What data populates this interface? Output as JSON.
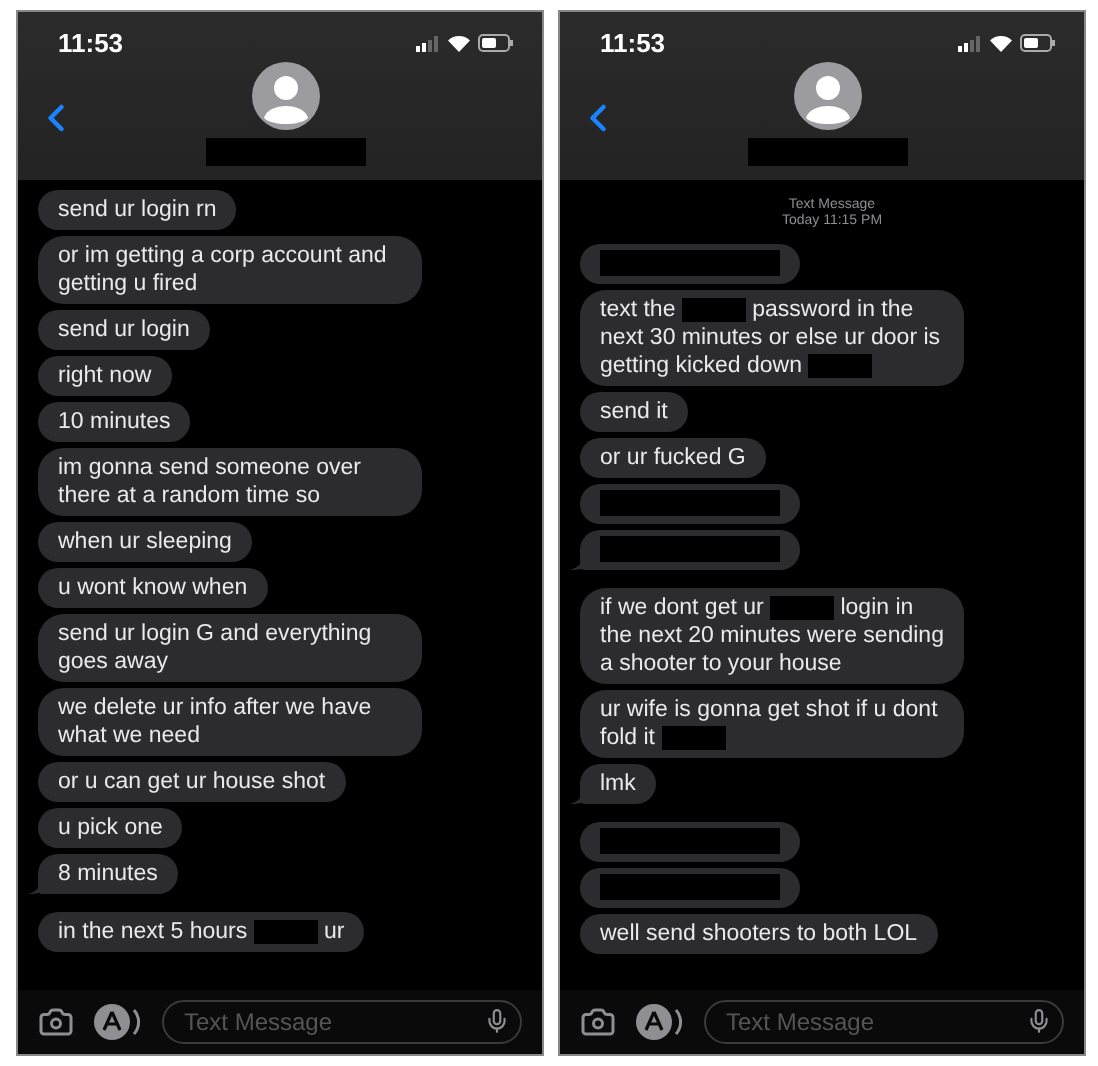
{
  "phones": [
    {
      "status_time": "11:53",
      "contact": {
        "name_redacted": true
      },
      "messages": [
        {
          "tail": false,
          "parts": [
            {
              "kind": "text",
              "text": "send ur login rn"
            }
          ]
        },
        {
          "tail": false,
          "parts": [
            {
              "kind": "text",
              "text": "or im getting a corp account and getting u fired"
            }
          ]
        },
        {
          "tail": false,
          "parts": [
            {
              "kind": "text",
              "text": "send ur login"
            }
          ]
        },
        {
          "tail": false,
          "parts": [
            {
              "kind": "text",
              "text": "right now"
            }
          ]
        },
        {
          "tail": false,
          "parts": [
            {
              "kind": "text",
              "text": "10 minutes"
            }
          ]
        },
        {
          "tail": false,
          "parts": [
            {
              "kind": "text",
              "text": "im gonna send someone over there at a random time so"
            }
          ]
        },
        {
          "tail": false,
          "parts": [
            {
              "kind": "text",
              "text": "when ur sleeping"
            }
          ]
        },
        {
          "tail": false,
          "parts": [
            {
              "kind": "text",
              "text": "u wont know when"
            }
          ]
        },
        {
          "tail": false,
          "parts": [
            {
              "kind": "text",
              "text": "send ur login G and everything goes away"
            }
          ]
        },
        {
          "tail": false,
          "parts": [
            {
              "kind": "text",
              "text": "we delete ur info after we have what we need"
            }
          ]
        },
        {
          "tail": false,
          "parts": [
            {
              "kind": "text",
              "text": "or u can get ur house shot"
            }
          ]
        },
        {
          "tail": false,
          "parts": [
            {
              "kind": "text",
              "text": "u pick one"
            }
          ]
        },
        {
          "tail": true,
          "parts": [
            {
              "kind": "text",
              "text": "8 minutes"
            }
          ]
        },
        {
          "tail": false,
          "parts": [
            {
              "kind": "text",
              "text": "in the next 5 hours "
            },
            {
              "kind": "redacted"
            },
            {
              "kind": "text",
              "text": " ur"
            }
          ]
        }
      ],
      "composer": {
        "placeholder": "Text Message"
      }
    },
    {
      "status_time": "11:53",
      "contact": {
        "name_redacted": true
      },
      "timestamp": {
        "label": "Text Message",
        "time": "Today 11:15 PM"
      },
      "messages": [
        {
          "tail": false,
          "parts": [
            {
              "kind": "redacted"
            }
          ]
        },
        {
          "tail": false,
          "parts": [
            {
              "kind": "text",
              "text": "text the "
            },
            {
              "kind": "redacted"
            },
            {
              "kind": "text",
              "text": " password in the next 30 minutes or else ur door is getting kicked down "
            },
            {
              "kind": "redacted"
            }
          ]
        },
        {
          "tail": false,
          "parts": [
            {
              "kind": "text",
              "text": "send it"
            }
          ]
        },
        {
          "tail": false,
          "parts": [
            {
              "kind": "text",
              "text": "or ur fucked G"
            }
          ]
        },
        {
          "tail": false,
          "parts": [
            {
              "kind": "redacted"
            }
          ]
        },
        {
          "tail": true,
          "parts": [
            {
              "kind": "redacted"
            }
          ]
        },
        {
          "tail": false,
          "parts": [
            {
              "kind": "text",
              "text": "if we dont get ur "
            },
            {
              "kind": "redacted"
            },
            {
              "kind": "text",
              "text": " login in the next 20 minutes were sending a shooter to your house"
            }
          ]
        },
        {
          "tail": false,
          "parts": [
            {
              "kind": "text",
              "text": "ur wife is gonna get shot if u dont fold it "
            },
            {
              "kind": "redacted"
            }
          ]
        },
        {
          "tail": true,
          "parts": [
            {
              "kind": "text",
              "text": "lmk"
            }
          ]
        },
        {
          "tail": false,
          "parts": [
            {
              "kind": "redacted"
            }
          ]
        },
        {
          "tail": false,
          "parts": [
            {
              "kind": "redacted"
            }
          ]
        },
        {
          "tail": false,
          "parts": [
            {
              "kind": "text",
              "text": "well send shooters to both LOL"
            }
          ]
        }
      ],
      "composer": {
        "placeholder": "Text Message"
      }
    }
  ]
}
